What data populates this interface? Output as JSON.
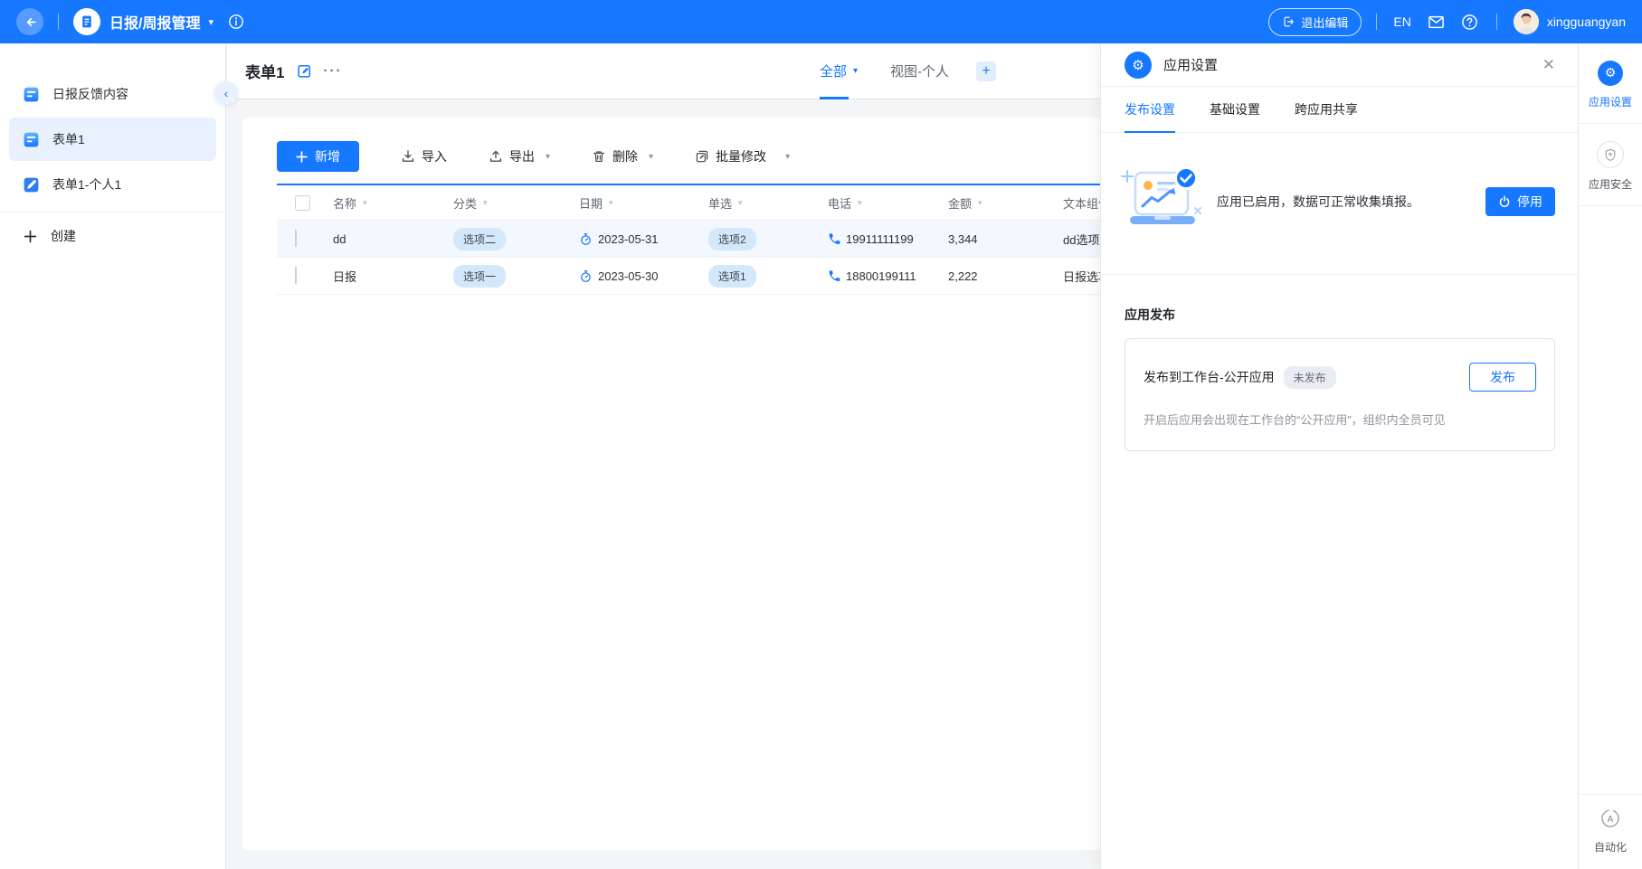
{
  "icons": {
    "caret_down": "▾",
    "ellipsis": "···",
    "chevron_left": "‹",
    "close": "✕",
    "gear": "⚙",
    "plus": "+"
  },
  "topbar": {
    "app_title": "日报/周报管理",
    "exit_edit_label": "退出编辑",
    "language_label": "EN",
    "username": "xingguangyan"
  },
  "sidebar": {
    "items": [
      {
        "label": "日报反馈内容"
      },
      {
        "label": "表单1"
      },
      {
        "label": "表单1-个人1"
      }
    ],
    "create_label": "创建"
  },
  "main": {
    "title": "表单1",
    "view_tabs": [
      {
        "label": "全部"
      },
      {
        "label": "视图-个人"
      }
    ],
    "toolbar": {
      "add": "新增",
      "import": "导入",
      "export": "导出",
      "delete": "删除",
      "batch_edit": "批量修改"
    },
    "table": {
      "columns": [
        "名称",
        "分类",
        "日期",
        "单选",
        "电话",
        "金额",
        "文本组件"
      ],
      "rows": [
        {
          "name": "dd",
          "category": "选项二",
          "date": "2023-05-31",
          "single_select": "选项2",
          "phone": "19911111199",
          "amount": "3,344",
          "text_group": "dd选项"
        },
        {
          "name": "日报",
          "category": "选项一",
          "date": "2023-05-30",
          "single_select": "选项1",
          "phone": "18800199111",
          "amount": "2,222",
          "text_group": "日报选项"
        }
      ]
    }
  },
  "settings_panel": {
    "title": "应用设置",
    "tabs": [
      {
        "label": "发布设置"
      },
      {
        "label": "基础设置"
      },
      {
        "label": "跨应用共享"
      }
    ],
    "status": {
      "message": "应用已启用，数据可正常收集填报。",
      "stop_label": "停用"
    },
    "publish": {
      "section_title": "应用发布",
      "item_title": "发布到工作台-公开应用",
      "badge": "未发布",
      "publish_label": "发布",
      "description": "开启后应用会出现在工作台的“公开应用”，组织内全员可见"
    }
  },
  "right_rail": {
    "items": [
      {
        "label": "应用设置"
      },
      {
        "label": "应用安全"
      },
      {
        "label": "自动化"
      }
    ]
  },
  "colors": {
    "primary": "#1677ff",
    "tag_bg": "#d4e8fb",
    "row_highlight": "#f2f8fd",
    "badge_bg": "#e9ecf3"
  }
}
